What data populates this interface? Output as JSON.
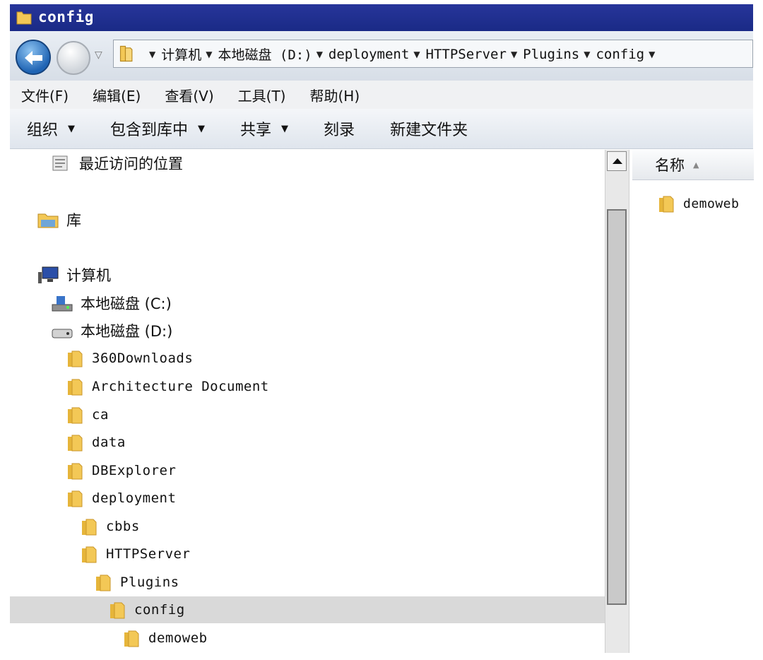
{
  "window": {
    "title": "config"
  },
  "address_bar": {
    "crumbs": [
      "计算机",
      "本地磁盘 (D:)",
      "deployment",
      "HTTPServer",
      "Plugins",
      "config"
    ]
  },
  "menu": [
    "文件(F)",
    "编辑(E)",
    "查看(V)",
    "工具(T)",
    "帮助(H)"
  ],
  "commands": {
    "organize": "组织",
    "include_in_library": "包含到库中",
    "share": "共享",
    "burn": "刻录",
    "new_folder": "新建文件夹"
  },
  "nav_tree": {
    "recent": "最近访问的位置",
    "libraries": "库",
    "computer": "计算机",
    "drive_c": "本地磁盘 (C:)",
    "drive_d": "本地磁盘 (D:)",
    "folders": {
      "f360": "360Downloads",
      "arch": "Architecture Document",
      "ca": "ca",
      "data": "data",
      "dbexplorer": "DBExplorer",
      "deployment": "deployment",
      "cbbs": "cbbs",
      "httpserver": "HTTPServer",
      "plugins": "Plugins",
      "config": "config",
      "demoweb": "demoweb"
    },
    "selected": "config"
  },
  "content": {
    "column_header": "名称",
    "items": [
      "demoweb"
    ]
  },
  "colors": {
    "title_bar": "#1a2a86",
    "selection": "#d9d9d9",
    "folder": "#f3c856"
  }
}
